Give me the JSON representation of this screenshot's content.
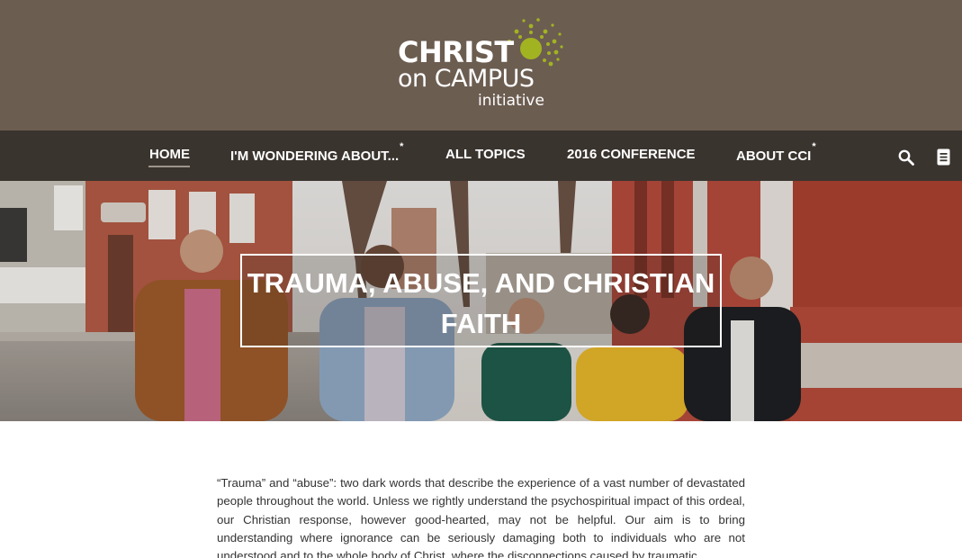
{
  "header": {
    "logo": {
      "line1": "CHRIST",
      "line2": "on CAMPUS",
      "line3": "initiative",
      "icon": "sun-burst-logo-icon",
      "accent_color": "#a2b321"
    },
    "background_color": "#6c5d51"
  },
  "nav": {
    "items": [
      {
        "label": "HOME",
        "has_submenu": false,
        "active": true
      },
      {
        "label": "I'M WONDERING ABOUT...",
        "has_submenu": true,
        "active": false
      },
      {
        "label": "ALL TOPICS",
        "has_submenu": false,
        "active": false
      },
      {
        "label": "2016 CONFERENCE",
        "has_submenu": false,
        "active": false
      },
      {
        "label": "ABOUT CCI",
        "has_submenu": true,
        "active": false
      }
    ],
    "submenu_marker": "*",
    "search_icon": "search-icon",
    "menu_icon": "document-menu-icon",
    "background_color": "#3a342f"
  },
  "hero": {
    "title": "TRAUMA, ABUSE, AND CHRISTIAN FAITH"
  },
  "article": {
    "intro": "“Trauma” and “abuse”: two dark words that describe the experience of a vast number of devastated people throughout the world. Unless we rightly understand the psychospiritual impact of this ordeal, our Christian response, however good-hearted, may not be helpful. Our aim is to bring understanding where ignorance can be seriously damaging both to individuals who are not understood and to the whole body of Christ, where the disconnections caused by traumatic"
  }
}
